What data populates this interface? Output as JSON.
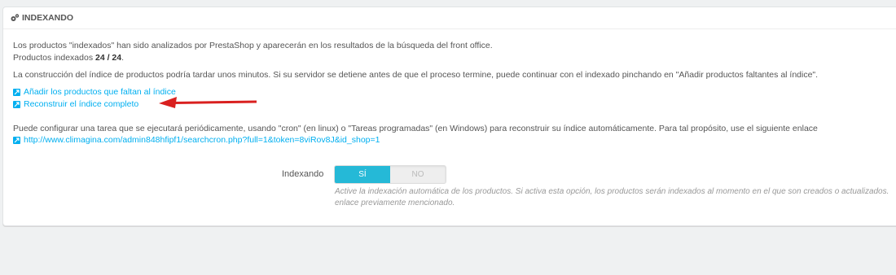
{
  "panel": {
    "title": "INDEXANDO",
    "title_icon": "cogs-icon"
  },
  "intro": {
    "line1": "Los productos \"indexados\" han sido analizados por PrestaShop y aparecerán en los resultados de la búsqueda del front office.",
    "indexed_label": "Productos indexados",
    "indexed_value": "24 / 24",
    "indexed_suffix": ".",
    "warning": "La construcción del índice de productos podría tardar unos minutos. Si su servidor se detiene antes de que el proceso termine, puede continuar con el indexado pinchando en \"Añadir productos faltantes al índice\"."
  },
  "links": {
    "add_missing": "Añadir los productos que faltan al índice",
    "rebuild": "Reconstruir el índice completo",
    "cron_url": "http://www.climagina.com/admin848hfipf1/searchcron.php?full=1&token=8viRov8J&id_shop=1"
  },
  "cron_text": "Puede configurar una tarea que se ejecutará periódicamente, usando \"cron\" (en linux) o \"Tareas programadas\" (en Windows) para reconstruir su índice automáticamente. Para tal propósito, use el siguiente enlace",
  "toggle": {
    "label": "Indexando",
    "on_label": "SÍ",
    "off_label": "NO",
    "selected": "SÍ",
    "help": "Active la indexación automática de los productos. Si activa esta opción, los productos serán indexados al momento en el que son creados o actualizados. enlace previamente mencionado."
  },
  "colors": {
    "accent": "#25b9d7",
    "link": "#00aff0",
    "arrow": "#d9201f"
  }
}
